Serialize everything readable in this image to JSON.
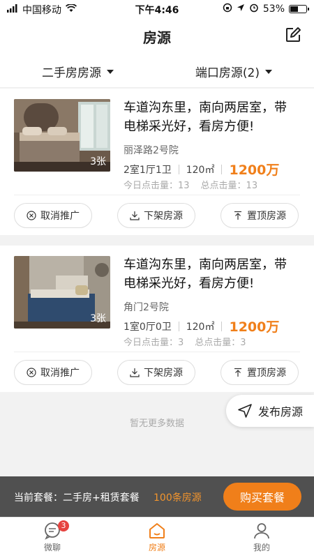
{
  "status_bar": {
    "carrier": "中国移动",
    "time": "下午4:46",
    "battery": "53%",
    "battery_level": 0.53
  },
  "header": {
    "title": "房源",
    "edit_icon": "edit-icon"
  },
  "filters": [
    {
      "label": "二手房房源"
    },
    {
      "label": "端口房源(2)"
    }
  ],
  "listings": [
    {
      "title": "车道沟东里，南向两居室，带电梯采光好，看房方便!",
      "photo_count": "3张",
      "address": "丽泽路2号院",
      "layout": "2室1厅1卫",
      "area": "120㎡",
      "price": "1200万",
      "today_clicks": "今日点击量：13",
      "total_clicks": "总点击量：13"
    },
    {
      "title": "车道沟东里，南向两居室，带电梯采光好，看房方便!",
      "photo_count": "3张",
      "address": "角门2号院",
      "layout": "1室0厅0卫",
      "area": "120㎡",
      "price": "1200万",
      "today_clicks": "今日点击量：3",
      "total_clicks": "总点击量：3"
    }
  ],
  "actions": {
    "cancel_promo": "取消推广",
    "delist": "下架房源",
    "pin_top": "置顶房源"
  },
  "no_more_text": "暂无更多数据",
  "publish_button": "发布房源",
  "package_bar": {
    "label": "当前套餐：二手房+租赁套餐",
    "count": "100条房源",
    "buy_button": "购买套餐"
  },
  "tabs": [
    {
      "label": "微聊",
      "icon": "chat-icon",
      "badge": "3"
    },
    {
      "label": "房源",
      "icon": "home-icon"
    },
    {
      "label": "我的",
      "icon": "user-icon"
    }
  ],
  "colors": {
    "accent": "#f07f1a",
    "package_bg": "#505050"
  }
}
